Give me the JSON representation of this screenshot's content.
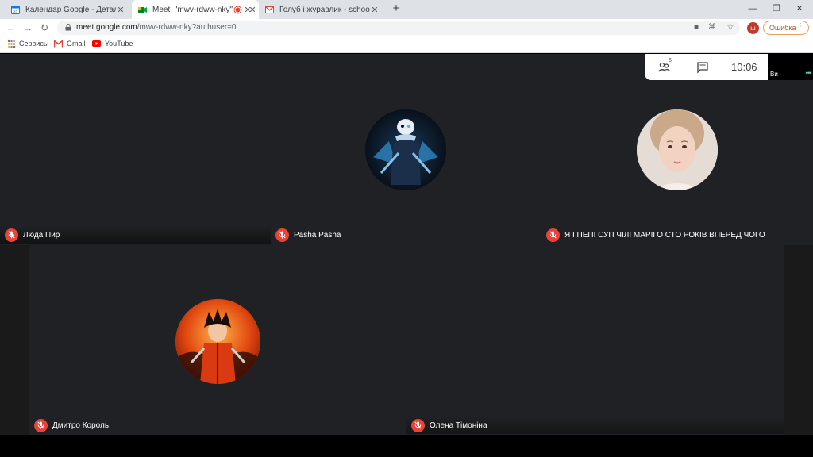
{
  "browser": {
    "tabs": [
      {
        "title": "Календар Google - Деталі події",
        "active": false
      },
      {
        "title": "Meet: \"mwv-rdww-nky\"",
        "active": true
      },
      {
        "title": "",
        "active": false,
        "recording": true
      },
      {
        "title": "Голуб і журавлик - schoolnextw",
        "active": false
      }
    ],
    "url_host": "meet.google.com",
    "url_path": "/mwv-rdww-nky?authuser=0",
    "profile_initial": "ш",
    "error_label": "Ошибка",
    "bookmarks": [
      "Сервисы",
      "Gmail",
      "YouTube"
    ]
  },
  "meet": {
    "participant_count": "6",
    "clock": "10:06",
    "self_label": "Ви",
    "tiles": [
      {
        "name": "Люда Пир",
        "muted": true
      },
      {
        "name": "Pasha Pasha",
        "muted": true
      },
      {
        "name": "Я І ПЕПІ СУП ЧІЛІ МАРІГО СТО РОКІВ ВПЕРЕД ЧОГО",
        "muted": true
      },
      {
        "name": "Дмитро Король",
        "muted": true
      },
      {
        "name": "Олена Тімоніна",
        "muted": true
      }
    ]
  },
  "colors": {
    "meet_bg": "#202124",
    "mic_muted": "#ea4335",
    "chrome_tabstrip": "#dee1e6",
    "error_accent": "#e8710a"
  }
}
